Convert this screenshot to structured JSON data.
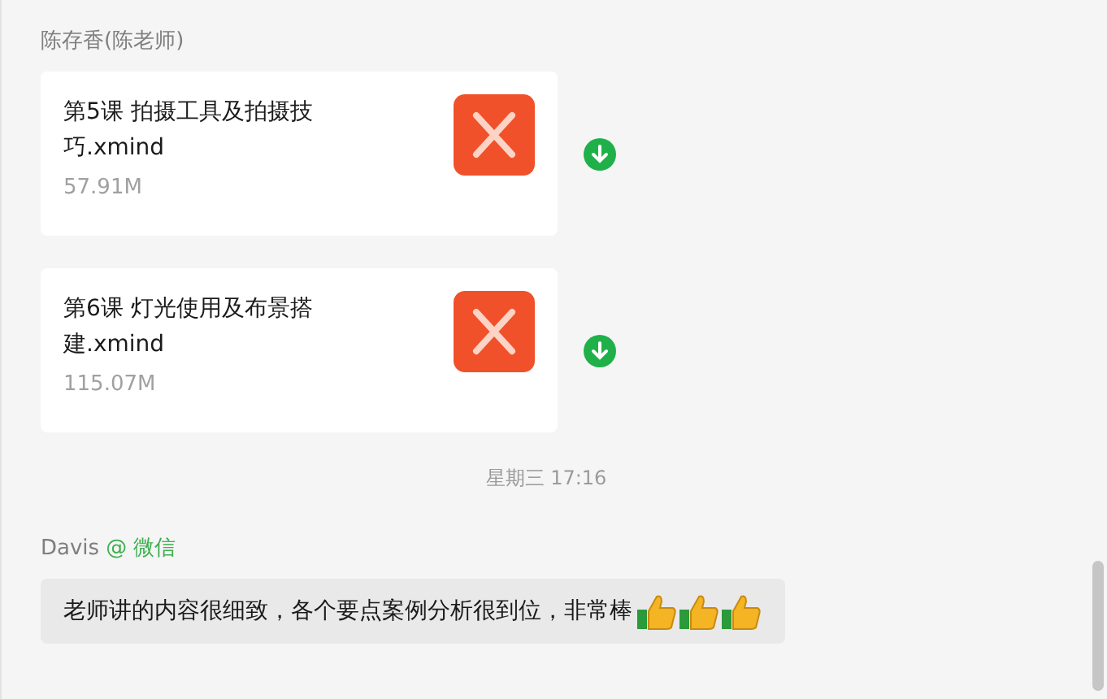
{
  "messages": [
    {
      "kind": "files",
      "sender": "陈存香(陈老师)",
      "files": [
        {
          "name": "第5课 拍摄工具及拍摄技巧.xmind",
          "size": "57.91M"
        },
        {
          "name": "第6课 灯光使用及布景搭建.xmind",
          "size": "115.07M"
        }
      ]
    },
    {
      "kind": "time",
      "text": "星期三 17:16"
    },
    {
      "kind": "text",
      "sender": "Davis",
      "source": "@ 微信",
      "text": "老师讲的内容很细致，各个要点案例分析很到位，非常棒",
      "emoji": [
        {
          "kind": "thumbs-up"
        },
        {
          "kind": "thumbs-up"
        },
        {
          "kind": "thumbs-up"
        }
      ]
    }
  ]
}
